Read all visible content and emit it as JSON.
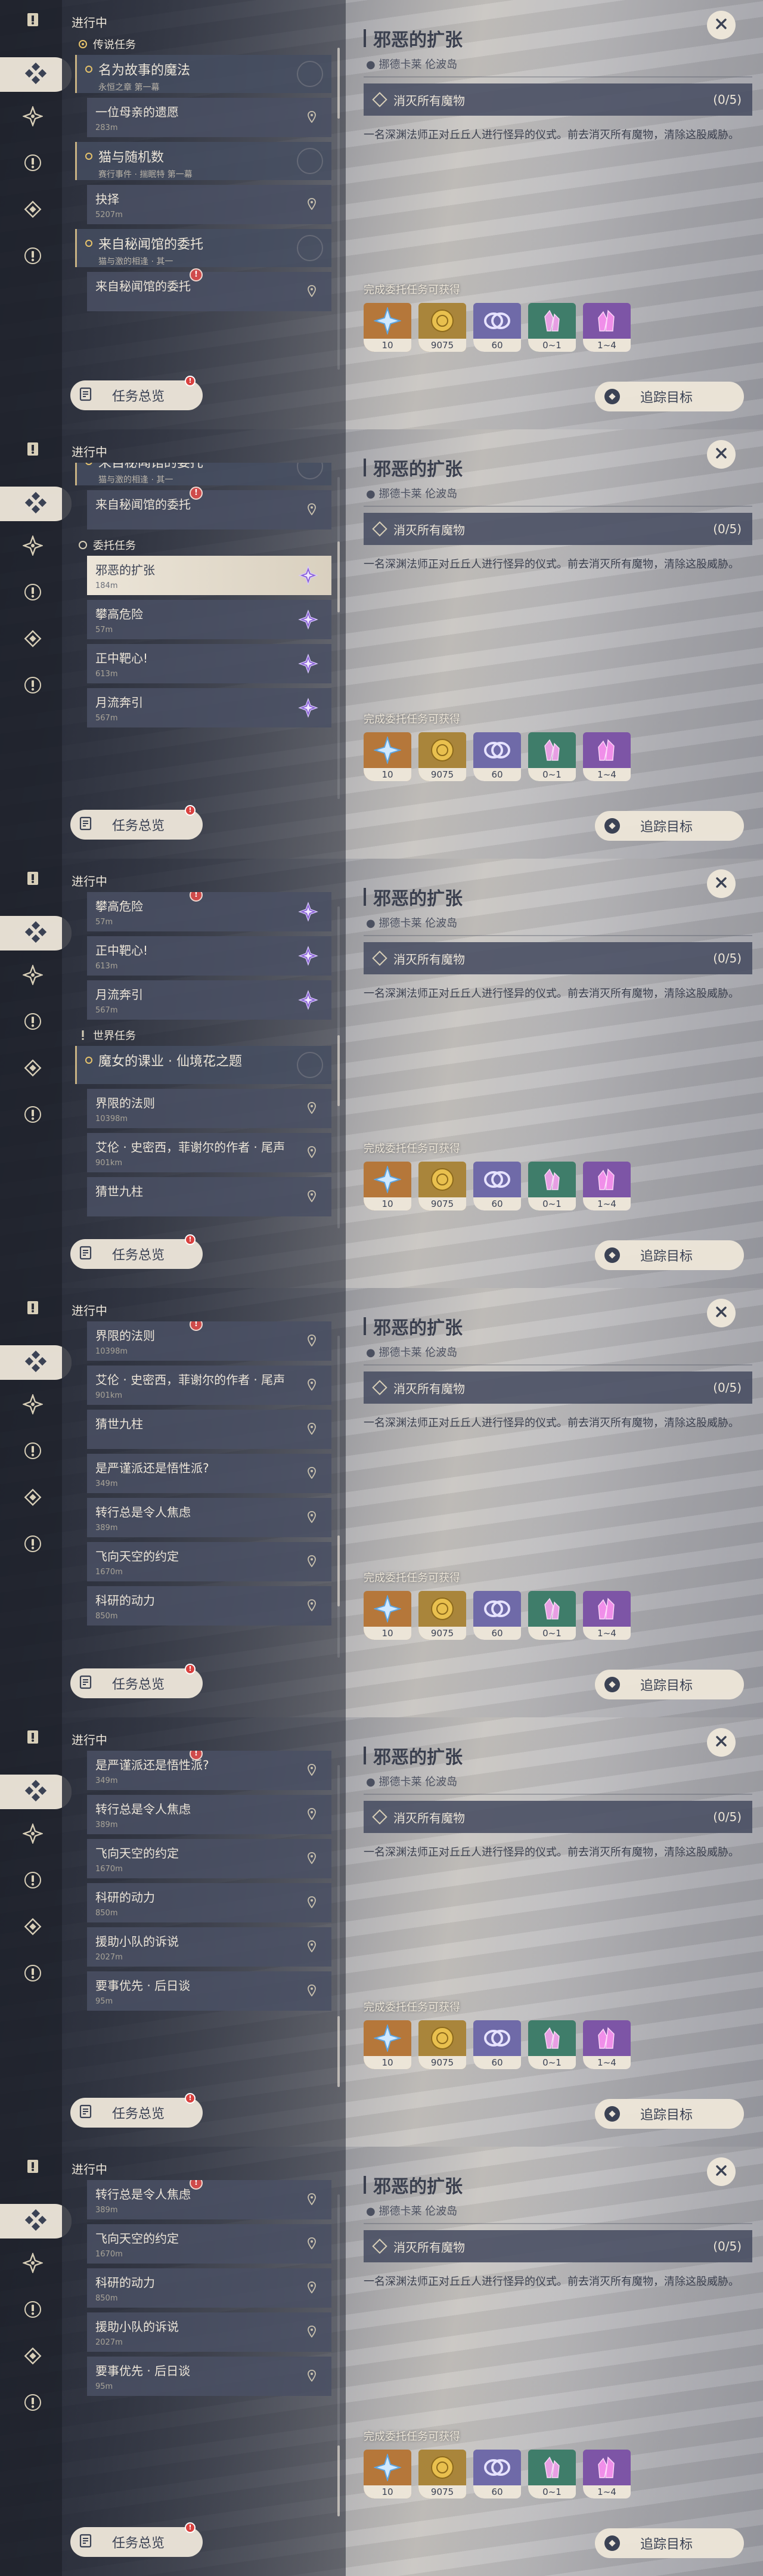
{
  "status": "进行中",
  "nav_icons": [
    "quest-book-icon",
    "compass-icon",
    "exclamation-icon",
    "diamond-icon",
    "exclamation-icon"
  ],
  "overview_label": "任务总览",
  "overview_badge": "!",
  "track_label": "追踪目标",
  "detail": {
    "title": "邪恶的扩张",
    "location": "挪德卡莱 伦波岛",
    "objective": "消灭所有魔物",
    "objective_progress": "(0/5)",
    "description": "一名深渊法师正对丘丘人进行怪异的仪式。前去消灭所有魔物，清除这股威胁。",
    "rewards_label": "完成委托任务可获得",
    "rewards": [
      {
        "name": "adventure-exp-icon",
        "count": "10",
        "color": "#b5773a"
      },
      {
        "name": "mora-icon",
        "count": "9075",
        "color": "#a9853b"
      },
      {
        "name": "companionship-exp-icon",
        "count": "60",
        "color": "#6f6aa8"
      },
      {
        "name": "crystal-green-icon",
        "count": "0~1",
        "color": "#3f7d6a"
      },
      {
        "name": "crystal-purple-icon",
        "count": "1~4",
        "color": "#7d55a6"
      }
    ]
  },
  "frames": [
    {
      "thumb": [
        0,
        22
      ],
      "items": [
        {
          "kind": "cat",
          "icon": "legend",
          "label": "传说任务"
        },
        {
          "kind": "group",
          "title": "名为故事的魔法",
          "sub": "永恒之章 第一幕"
        },
        {
          "kind": "quest",
          "name": "一位母亲的遗愿",
          "dist": "283m"
        },
        {
          "kind": "group",
          "title": "猫与随机数",
          "sub": "赛行事件 · 揣眠特 第一幕"
        },
        {
          "kind": "quest",
          "name": "抉择",
          "dist": "5207m"
        },
        {
          "kind": "group",
          "title": "来自秘闻馆的委托",
          "sub": "猫与激的相逢 · 其一"
        },
        {
          "kind": "quest",
          "name": "来自秘闻馆的委托",
          "dist": "",
          "badge": true
        }
      ]
    },
    {
      "thumb": [
        20,
        22
      ],
      "items": [
        {
          "kind": "group",
          "title": "来自秘闻馆的委托",
          "sub": "猫与激的相逢 · 其一",
          "offset": -26
        },
        {
          "kind": "quest",
          "name": "来自秘闻馆的委托",
          "dist": "",
          "badge": true
        },
        {
          "kind": "cat",
          "icon": "commission",
          "label": "委托任务"
        },
        {
          "kind": "quest",
          "name": "邪恶的扩张",
          "dist": "184m",
          "gem": true,
          "selected": true
        },
        {
          "kind": "quest",
          "name": "攀高危险",
          "dist": "57m",
          "gem": true
        },
        {
          "kind": "quest",
          "name": "正中靶心!",
          "dist": "613m",
          "gem": true
        },
        {
          "kind": "quest",
          "name": "月流奔引",
          "dist": "567m",
          "gem": true
        }
      ]
    },
    {
      "thumb": [
        40,
        22
      ],
      "items": [
        {
          "kind": "quest",
          "name": "攀高危险",
          "dist": "57m",
          "gem": true,
          "badge": true
        },
        {
          "kind": "quest",
          "name": "正中靶心!",
          "dist": "613m",
          "gem": true
        },
        {
          "kind": "quest",
          "name": "月流奔引",
          "dist": "567m",
          "gem": true
        },
        {
          "kind": "cat",
          "icon": "world",
          "label": "世界任务"
        },
        {
          "kind": "group",
          "title": "魔女的课业 · 仙境花之题",
          "sub": ""
        },
        {
          "kind": "quest",
          "name": "界限的法则",
          "dist": "10398m"
        },
        {
          "kind": "quest",
          "name": "艾伦 · 史密西，菲谢尔的作者 · 尾声",
          "dist": "901km"
        },
        {
          "kind": "quest",
          "name": "猜世九柱",
          "dist": ""
        }
      ]
    },
    {
      "thumb": [
        62,
        22
      ],
      "items": [
        {
          "kind": "quest",
          "name": "界限的法则",
          "dist": "10398m",
          "badge": true
        },
        {
          "kind": "quest",
          "name": "艾伦 · 史密西，菲谢尔的作者 · 尾声",
          "dist": "901km"
        },
        {
          "kind": "quest",
          "name": "猜世九柱",
          "dist": ""
        },
        {
          "kind": "quest",
          "name": "是严谨派还是悟性派?",
          "dist": "349m"
        },
        {
          "kind": "quest",
          "name": "转行总是令人焦虑",
          "dist": "389m"
        },
        {
          "kind": "quest",
          "name": "飞向天空的约定",
          "dist": "1670m"
        },
        {
          "kind": "quest",
          "name": "科研的动力",
          "dist": "850m"
        }
      ]
    },
    {
      "thumb": [
        78,
        22
      ],
      "items": [
        {
          "kind": "quest",
          "name": "是严谨派还是悟性派?",
          "dist": "349m",
          "badge": true
        },
        {
          "kind": "quest",
          "name": "转行总是令人焦虑",
          "dist": "389m"
        },
        {
          "kind": "quest",
          "name": "飞向天空的约定",
          "dist": "1670m"
        },
        {
          "kind": "quest",
          "name": "科研的动力",
          "dist": "850m"
        },
        {
          "kind": "quest",
          "name": "援助小队的诉说",
          "dist": "2027m"
        },
        {
          "kind": "quest",
          "name": "要事优先 · 后日谈",
          "dist": "95m"
        }
      ]
    },
    {
      "thumb": [
        78,
        22
      ],
      "items": [
        {
          "kind": "quest",
          "name": "转行总是令人焦虑",
          "dist": "389m",
          "badge": true
        },
        {
          "kind": "quest",
          "name": "飞向天空的约定",
          "dist": "1670m"
        },
        {
          "kind": "quest",
          "name": "科研的动力",
          "dist": "850m"
        },
        {
          "kind": "quest",
          "name": "援助小队的诉说",
          "dist": "2027m"
        },
        {
          "kind": "quest",
          "name": "要事优先 · 后日谈",
          "dist": "95m"
        }
      ]
    }
  ]
}
